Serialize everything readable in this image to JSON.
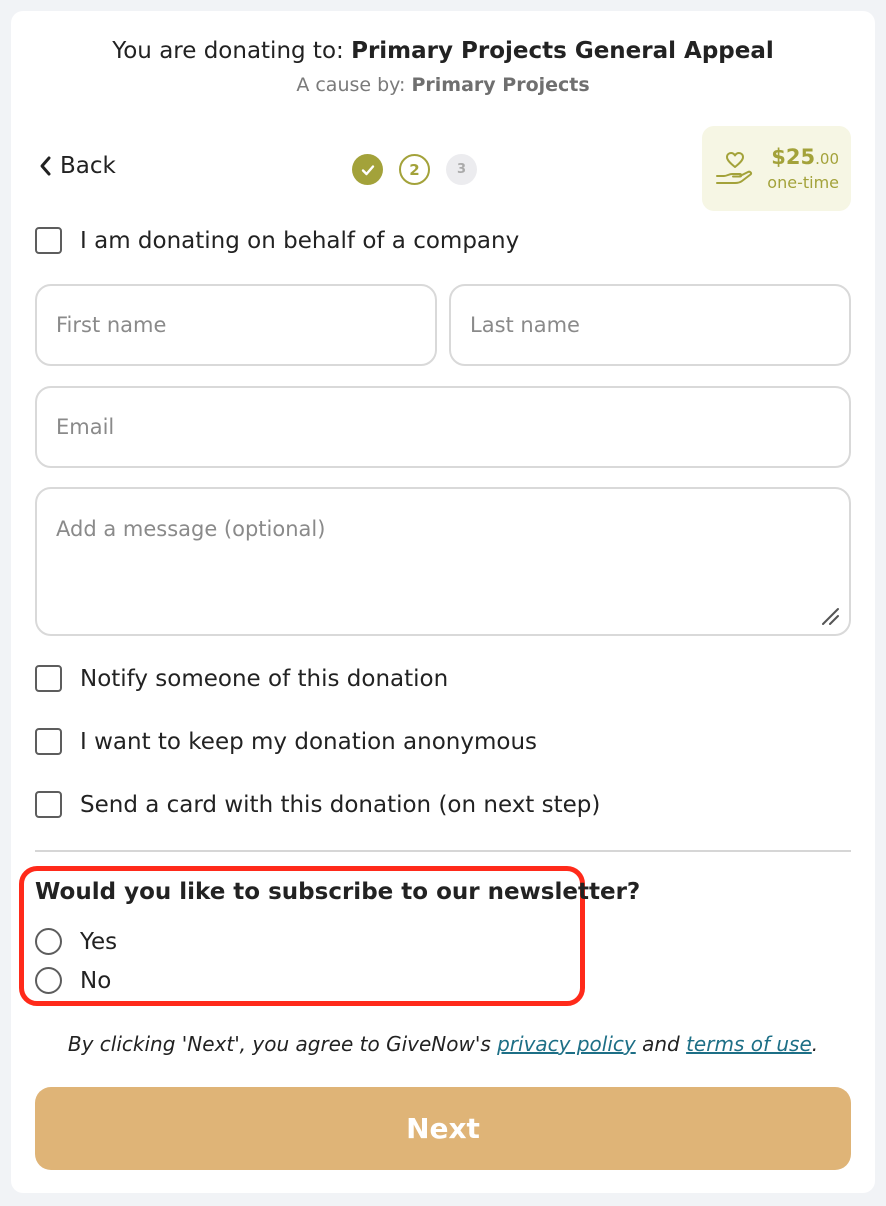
{
  "header": {
    "donating_prefix": "You are donating to: ",
    "cause_name": "Primary Projects General Appeal",
    "cause_by_prefix": "A cause by: ",
    "organization": "Primary Projects"
  },
  "nav": {
    "back_label": "Back",
    "steps": [
      {
        "label": "",
        "state": "completed"
      },
      {
        "label": "2",
        "state": "current"
      },
      {
        "label": "3",
        "state": "upcoming"
      }
    ]
  },
  "donation_summary": {
    "amount_whole": "$25",
    "amount_cents": ".00",
    "frequency": "one-time",
    "icon": "hand-heart-icon"
  },
  "form": {
    "company_checkbox_label": "I am donating on behalf of a company",
    "first_name": {
      "placeholder": "First name",
      "value": ""
    },
    "last_name": {
      "placeholder": "Last name",
      "value": ""
    },
    "email": {
      "placeholder": "Email",
      "value": ""
    },
    "message": {
      "placeholder": "Add a message (optional)",
      "value": ""
    },
    "options": [
      {
        "label": "Notify someone of this donation",
        "checked": false
      },
      {
        "label": "I want to keep my donation anonymous",
        "checked": false
      },
      {
        "label": "Send a card with this donation (on next step)",
        "checked": false
      }
    ]
  },
  "newsletter": {
    "question": "Would you like to subscribe to our newsletter?",
    "options": [
      "Yes",
      "No"
    ],
    "selected": null
  },
  "legal": {
    "prefix": "By clicking 'Next', you agree to GiveNow's ",
    "privacy_link": "privacy policy",
    "conjunction": " and ",
    "terms_link": "terms of use",
    "suffix": "."
  },
  "submit": {
    "label": "Next"
  },
  "colors": {
    "accent_olive": "#a3a23a",
    "next_button": "#dfb477",
    "highlight_border": "#ff2a1a",
    "link": "#1d6f86"
  }
}
